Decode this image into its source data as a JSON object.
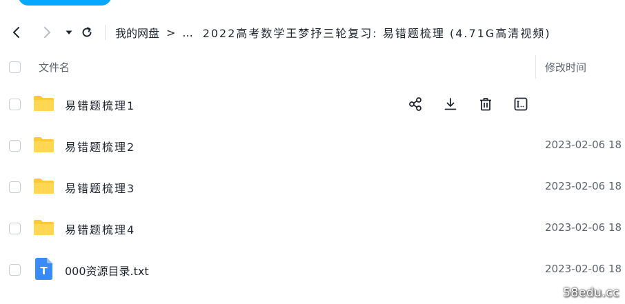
{
  "nav": {
    "breadcrumb_root": "我的网盘",
    "breadcrumb_separator": ">",
    "breadcrumb_ellipsis": "...",
    "breadcrumb_current": "2022高考数学王梦抒三轮复习: 易错题梳理 (4.71G高清视频)",
    "icons": [
      "back-icon",
      "forward-icon",
      "history-dropdown-icon",
      "refresh-icon"
    ]
  },
  "table": {
    "columns": {
      "name": "文件名",
      "modified": "修改时间"
    },
    "rows": [
      {
        "name": "易错题梳理1",
        "type": "folder",
        "modified": ""
      },
      {
        "name": "易错题梳理2",
        "type": "folder",
        "modified": "2023-02-06 18"
      },
      {
        "name": "易错题梳理3",
        "type": "folder",
        "modified": "2023-02-06 18"
      },
      {
        "name": "易错题梳理4",
        "type": "folder",
        "modified": "2023-02-06 18"
      },
      {
        "name": "000资源目录.txt",
        "type": "txt",
        "modified": "2023-02-06 18"
      }
    ]
  },
  "row_actions": [
    "share-icon",
    "download-icon",
    "delete-icon",
    "rename-icon"
  ],
  "txt_icon_letter": "T",
  "watermark": "58edu.cc",
  "colors": {
    "accent": "#06a7ff",
    "folder": "#ffc936",
    "txt_icon": "#3a8bf7",
    "text": "#1f2430",
    "muted": "#5e6370"
  }
}
